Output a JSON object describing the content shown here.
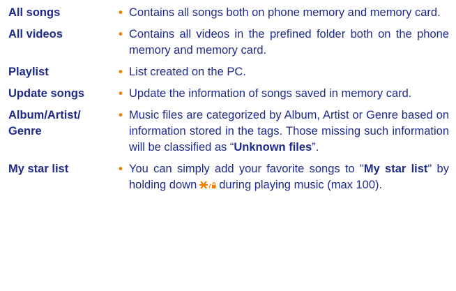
{
  "colors": {
    "text": "#1e2a8a",
    "bullet": "#f07d00",
    "background": "#ffffff"
  },
  "bullet_glyph": "•",
  "entries": [
    {
      "term": "All songs",
      "desc": "Contains all songs both on phone memory and memory card."
    },
    {
      "term": "All videos",
      "desc": "Contains all videos in the prefined folder both on the phone memory and memory card."
    },
    {
      "term": "Playlist",
      "desc": "List created on the PC."
    },
    {
      "term": "Update songs",
      "desc": "Update the information of songs saved in memory card."
    },
    {
      "term_line1": "Album/Artist/",
      "term_line2": "Genre",
      "desc_pre": "Music files are categorized by Album, Artist or Genre based on information stored in the tags. Those missing such information will be classified as “",
      "desc_bold": "Unknown files",
      "desc_post": "”."
    },
    {
      "term": "My star list",
      "desc_pre": "You can simply add your favorite songs to \"",
      "desc_bold": "My star list",
      "desc_mid": "\" by holding down",
      "key_icon": "star-lock-key-icon",
      "desc_post": "during playing music (max 100)."
    }
  ]
}
